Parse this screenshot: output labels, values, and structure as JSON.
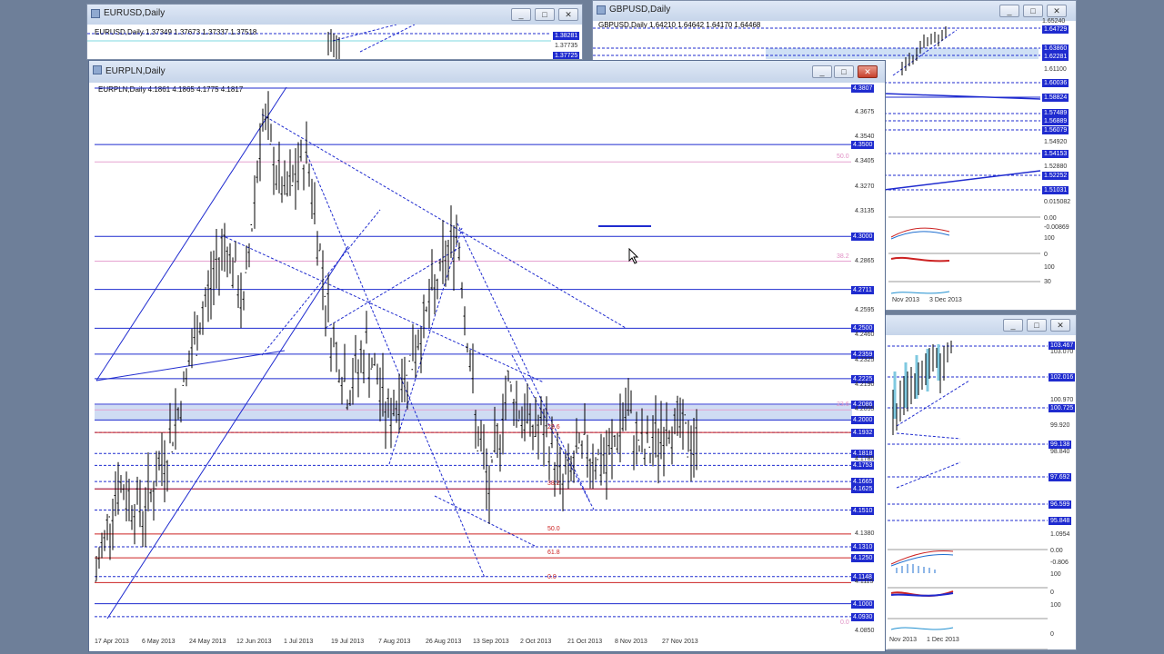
{
  "windows": {
    "eurusd": {
      "title": "EURUSD,Daily",
      "ohlc": "EURUSD,Daily  1.37349 1.37673 1.37337 1.37518",
      "price_labels": [
        "1.38281",
        "1.37735",
        "1.37725"
      ]
    },
    "gbpusd": {
      "title": "GBPUSD,Daily",
      "ohlc": "GBPUSD,Daily  1.64210 1.64642 1.64170 1.64468",
      "price_labels": [
        "1.65240",
        "1.64729",
        "1.63860",
        "1.62281",
        "1.61100",
        "1.60036",
        "1.58824",
        "1.57489",
        "1.56889",
        "1.56079",
        "1.54920",
        "1.54153",
        "1.52880",
        "1.52252",
        "1.51031"
      ],
      "osc_labels": [
        "0.015082",
        "0.00",
        "-0.00869",
        "100",
        "0",
        "100",
        "30"
      ],
      "dates": [
        "Nov 2013",
        "3 Dec 2013"
      ]
    },
    "third": {
      "price_labels": [
        "103.467",
        "103.070",
        "102.016",
        "100.970",
        "100.725",
        "99.920",
        "99.138",
        "98.840",
        "97.692",
        "96.599",
        "95.848"
      ],
      "osc_labels": [
        "1.0954",
        "0.00",
        "-0.806",
        "100",
        "0",
        "100",
        "0"
      ],
      "dates": [
        "Nov 2013",
        "1 Dec 2013"
      ]
    },
    "eurpln": {
      "title": "EURPLN,Daily",
      "ohlc": "EURPLN,Daily  4.1861 4.1865 4.1775 4.1817",
      "price_axis": [
        "4.3807",
        "4.3675",
        "4.3540",
        "4.3500",
        "4.3405",
        "4.3270",
        "4.3135",
        "4.3000",
        "4.2865",
        "4.2711",
        "4.2595",
        "4.2500",
        "4.2460",
        "4.2359",
        "4.2325",
        "4.2225",
        "4.2190",
        "4.2086",
        "4.2055",
        "4.2000",
        "4.1932",
        "4.1818",
        "4.1785",
        "4.1753",
        "4.1665",
        "4.1625",
        "4.1510",
        "4.1380",
        "4.1310",
        "4.1250",
        "4.1148",
        "4.1115",
        "4.1000",
        "4.0930",
        "4.0850"
      ],
      "dates": [
        "17 Apr 2013",
        "6 May 2013",
        "24 May 2013",
        "12 Jun 2013",
        "1 Jul 2013",
        "19 Jul 2013",
        "7 Aug 2013",
        "26 Aug 2013",
        "13 Sep 2013",
        "2 Oct 2013",
        "21 Oct 2013",
        "8 Nov 2013",
        "27 Nov 2013"
      ],
      "fib_labels": [
        "50.0",
        "38.2",
        "23.6",
        "0.0",
        "23.6",
        "38.2",
        "50.0",
        "61.8",
        "0.0"
      ],
      "colors": {
        "level_line": "#1f2bcf",
        "fib_pink": "#e6a2d0",
        "fib_red": "#cc2222",
        "label_bg": "#1f2bcf",
        "candle": "#000000"
      }
    }
  }
}
